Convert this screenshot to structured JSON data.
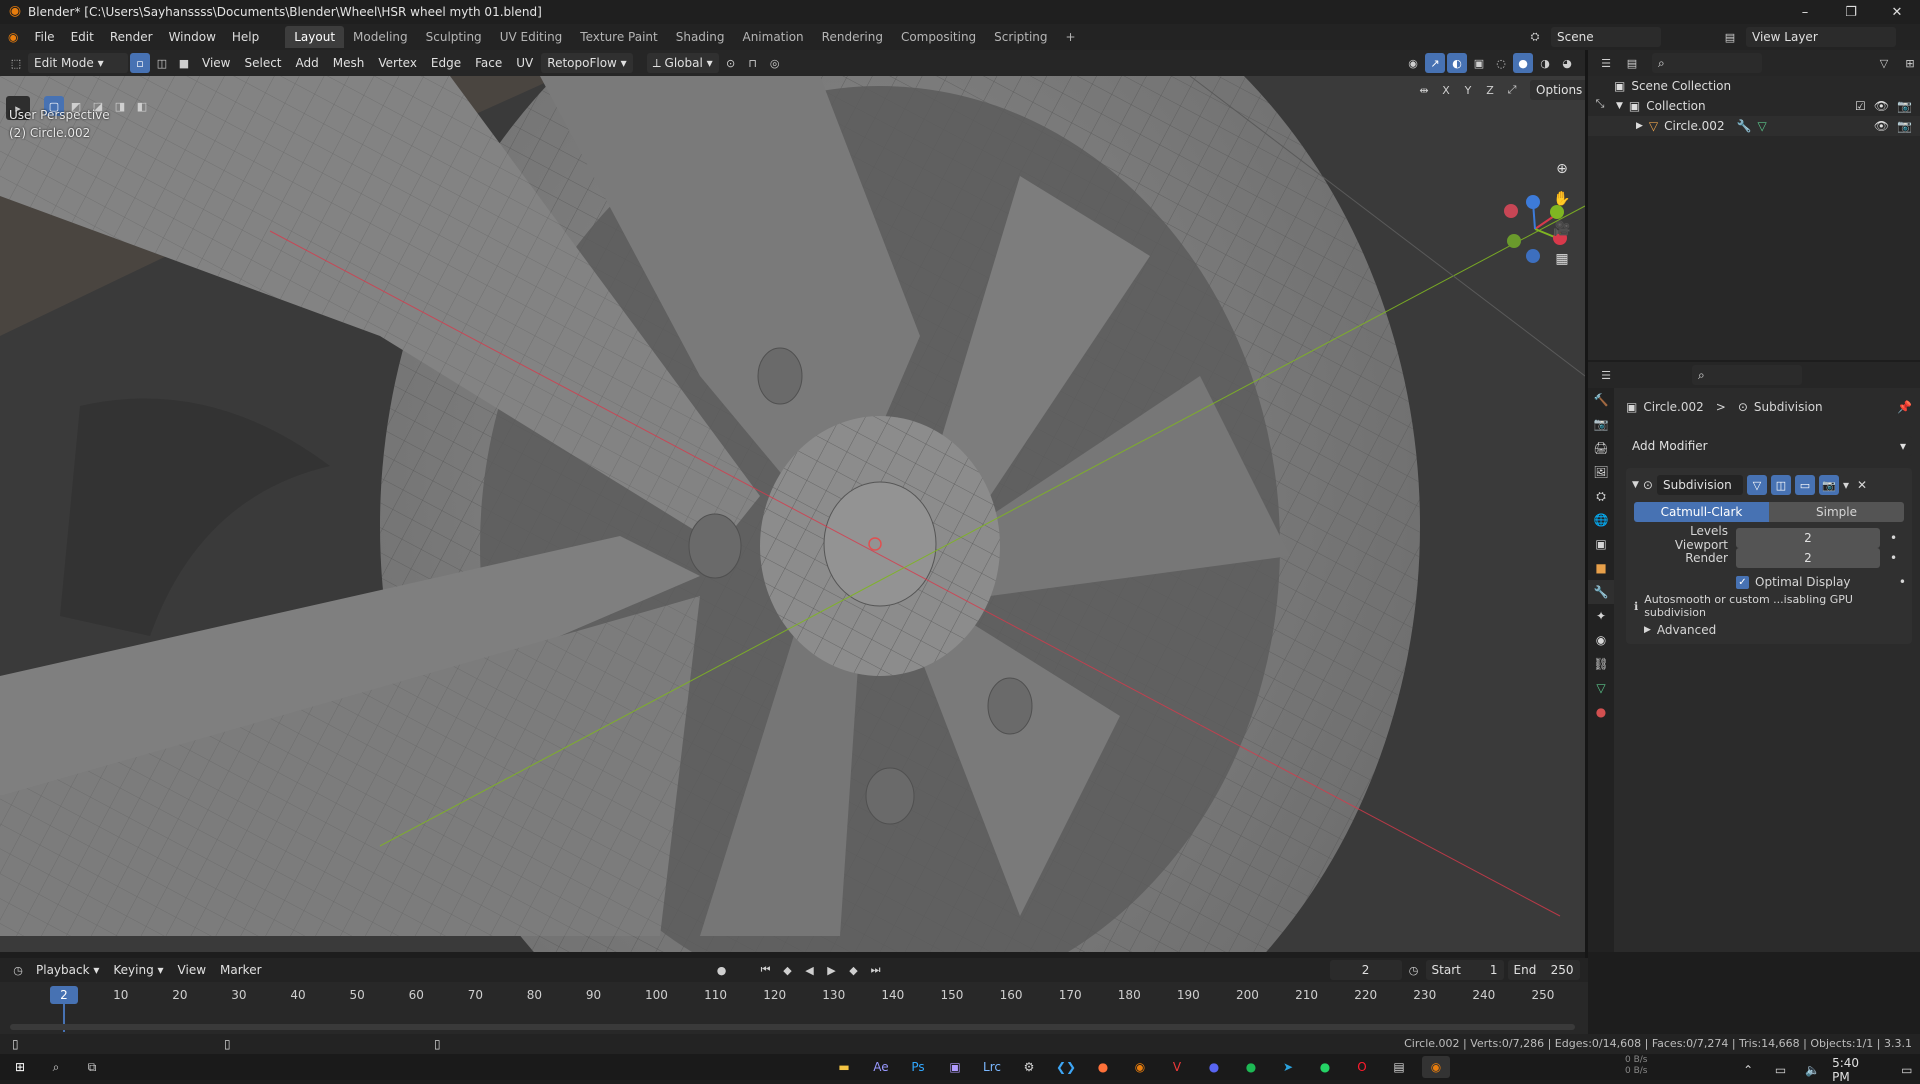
{
  "window": {
    "title": "Blender* [C:\\Users\\Sayhanssss\\Documents\\Blender\\Wheel\\HSR wheel myth 01.blend]"
  },
  "menu": [
    "File",
    "Edit",
    "Render",
    "Window",
    "Help"
  ],
  "workspaces": [
    "Layout",
    "Modeling",
    "Sculpting",
    "UV Editing",
    "Texture Paint",
    "Shading",
    "Animation",
    "Rendering",
    "Compositing",
    "Scripting"
  ],
  "add_workspace": "+",
  "scene": {
    "scene_name": "Scene",
    "view_layer": "View Layer"
  },
  "viewport_header": {
    "mode": "Edit Mode",
    "menus": [
      "View",
      "Select",
      "Add",
      "Mesh",
      "Vertex",
      "Edge",
      "Face",
      "UV"
    ],
    "addon": "RetopoFlow",
    "orientation": "Global",
    "options": "Options",
    "axes": [
      "X",
      "Y",
      "Z"
    ]
  },
  "viewport": {
    "view_name": "User Perspective",
    "object_line": "(2) Circle.002"
  },
  "outliner": {
    "scene_collection": "Scene Collection",
    "collection": "Collection",
    "object": "Circle.002"
  },
  "properties": {
    "breadcrumb_object": "Circle.002",
    "breadcrumb_sep": ">",
    "breadcrumb_modifier": "Subdivision",
    "add_modifier": "Add Modifier",
    "modifier_name": "Subdivision",
    "method_active": "Catmull-Clark",
    "method_other": "Simple",
    "levels_viewport_label": "Levels Viewport",
    "levels_viewport_value": "2",
    "render_label": "Render",
    "render_value": "2",
    "optimal_display": "Optimal Display",
    "info": "Autosmooth or custom ...isabling GPU subdivision",
    "advanced": "Advanced"
  },
  "timeline": {
    "menus": [
      "Playback",
      "Keying",
      "View",
      "Marker"
    ],
    "current_frame": "2",
    "start_label": "Start",
    "start": "1",
    "end_label": "End",
    "end": "250",
    "ticks": [
      "10",
      "20",
      "30",
      "40",
      "50",
      "60",
      "70",
      "80",
      "90",
      "100",
      "110",
      "120",
      "130",
      "140",
      "150",
      "160",
      "170",
      "180",
      "190",
      "200",
      "210",
      "220",
      "230",
      "240",
      "250"
    ]
  },
  "status": {
    "text": "Circle.002 | Verts:0/7,286 | Edges:0/14,608 | Faces:0/7,274 | Tris:14,668 | Objects:1/1 | 3.3.1"
  },
  "taskbar": {
    "clock": "5:40 PM",
    "net_up": "0 B/s",
    "net_down": "0 B/s"
  },
  "colors": {
    "accent": "#4772b3",
    "blender_orange": "#e87d0d",
    "x_axis": "#d8394b",
    "y_axis": "#7fb522",
    "z_axis": "#3d7bd9"
  }
}
